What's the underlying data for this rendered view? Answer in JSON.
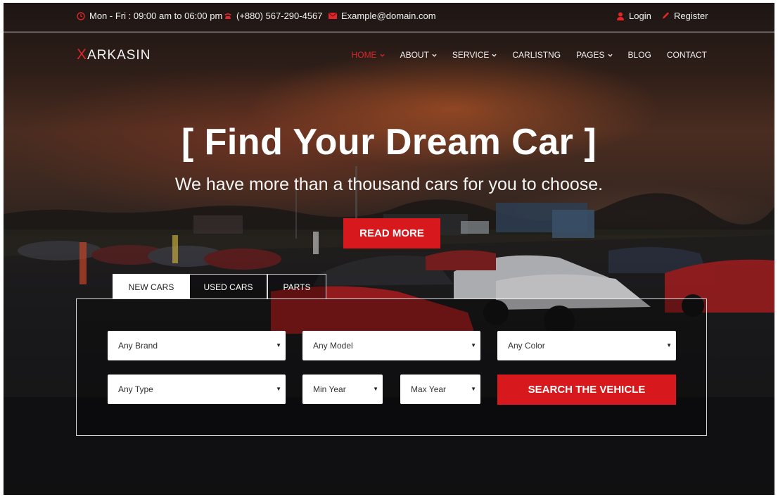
{
  "topbar": {
    "hours": "Mon - Fri : 09:00 am to 06:00 pm",
    "phone": "(+880) 567-290-4567",
    "email": "Example@domain.com",
    "login": "Login",
    "register": "Register"
  },
  "brand": {
    "logo_mark": "X",
    "logo_text": "ARKASIN"
  },
  "nav": {
    "items": [
      {
        "label": "HOME",
        "dropdown": true,
        "active": true
      },
      {
        "label": "ABOUT",
        "dropdown": true
      },
      {
        "label": "SERVICE",
        "dropdown": true
      },
      {
        "label": "CARLISTNG",
        "dropdown": false
      },
      {
        "label": "PAGES",
        "dropdown": true
      },
      {
        "label": "BLOG",
        "dropdown": false
      },
      {
        "label": "CONTACT",
        "dropdown": false
      }
    ]
  },
  "hero": {
    "title": "[ Find Your Dream Car ]",
    "subtitle": "We have more than a thousand cars for you to choose.",
    "cta": "READ MORE"
  },
  "search": {
    "tabs": [
      "NEW CARS",
      "USED CARS",
      "PARTS"
    ],
    "active_tab": "NEW CARS",
    "brand": "Any Brand",
    "model": "Any Model",
    "color": "Any Color",
    "type": "Any Type",
    "min_year": "Min Year",
    "max_year": "Max Year",
    "button": "SEARCH THE VEHICLE",
    "arrow_glyph": "▼"
  },
  "colors": {
    "accent": "#d7191d",
    "nav_active": "#e0262a",
    "text_light": "#ffffff"
  },
  "icons": [
    "clock-icon",
    "phone-icon",
    "envelope-icon",
    "user-icon",
    "pencil-icon",
    "chevron-down-icon"
  ]
}
